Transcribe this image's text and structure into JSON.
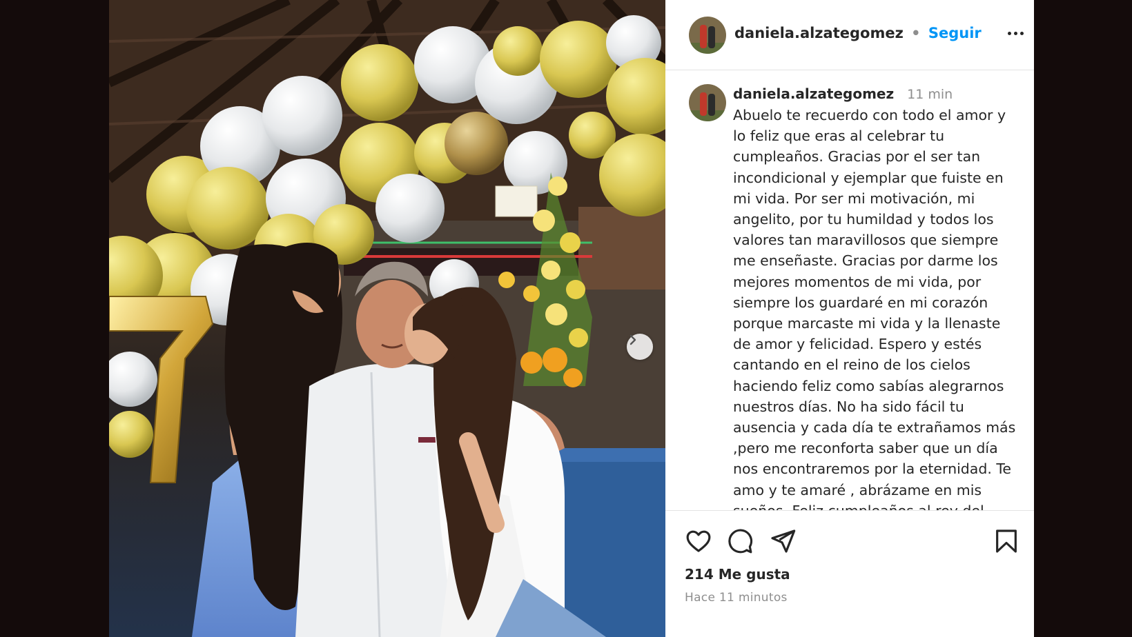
{
  "post": {
    "username": "daniela.alzategomez",
    "separator": "•",
    "follow_label": "Seguir",
    "caption_username": "daniela.alzategomez",
    "caption_time": "11 min",
    "caption_text": "Abuelo te recuerdo con todo el amor y\nlo feliz que eras al celebrar tu\ncumpleaños. Gracias por el ser tan\nincondicional y ejemplar que fuiste en\nmi vida. Por ser mi motivación, mi\nangelito, por tu humildad y todos los\nvalores tan maravillosos que siempre\nme enseñaste. Gracias por darme los\nmejores momentos de mi vida, por\nsiempre los guardaré en mi corazón\nporque marcaste mi vida y la llenaste\nde amor y felicidad. Espero y estés\ncantando en el reino de los cielos\nhaciendo feliz como sabías alegrarnos\nnuestros días. No ha sido fácil tu\nausencia y cada día te extrañamos más\n,pero me reconforta saber que un día\nnos encontraremos por la eternidad. Te\namo y te amaré , abrázame en mis\nsueños. Feliz cumpleaños al rey del",
    "likes": "214 Me gusta",
    "posted_ago": "Hace 11 minutos"
  },
  "photo": {
    "balloon_number": "7"
  },
  "icons": {
    "like": "heart-icon",
    "comment": "comment-icon",
    "share": "send-icon",
    "save": "bookmark-icon",
    "more": "more-icon",
    "next": "chevron-right-icon"
  },
  "colors": {
    "follow": "#0095f6",
    "text": "#262626",
    "muted": "#8e8e8e"
  }
}
